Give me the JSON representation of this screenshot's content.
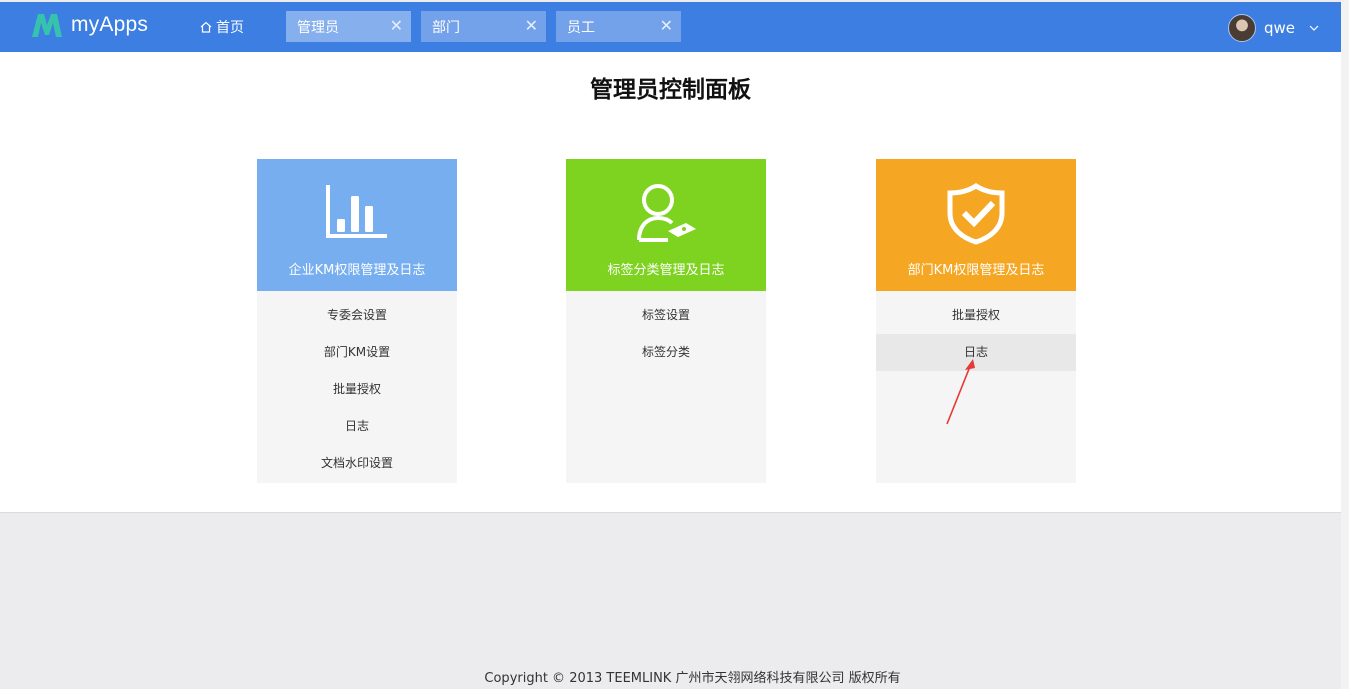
{
  "topbar": {
    "brand": "myApps",
    "home_label": "首页",
    "tabs": [
      {
        "label": "管理员",
        "close": "✕"
      },
      {
        "label": "部门",
        "close": "✕"
      },
      {
        "label": "员工",
        "close": "✕"
      }
    ],
    "user_name": "qwe"
  },
  "page_title": "管理员控制面板",
  "cards": [
    {
      "title": "企业KM权限管理及日志",
      "color": "#76aef0",
      "icon": "bar-chart-icon",
      "items": [
        "专委会设置",
        "部门KM设置",
        "批量授权",
        "日志",
        "文档水印设置"
      ]
    },
    {
      "title": "标签分类管理及日志",
      "color": "#7ed321",
      "icon": "user-tag-icon",
      "items": [
        "标签设置",
        "标签分类"
      ]
    },
    {
      "title": "部门KM权限管理及日志",
      "color": "#f5a623",
      "icon": "shield-check-icon",
      "items": [
        "批量授权",
        "日志"
      ]
    }
  ],
  "footer": "Copyright © 2013 TEEMLINK 广州市天翎网络科技有限公司 版权所有",
  "colors": {
    "topbar": "#3d7ee2",
    "brand_logo": "#36c3ad",
    "annotation_arrow": "#e53935"
  }
}
